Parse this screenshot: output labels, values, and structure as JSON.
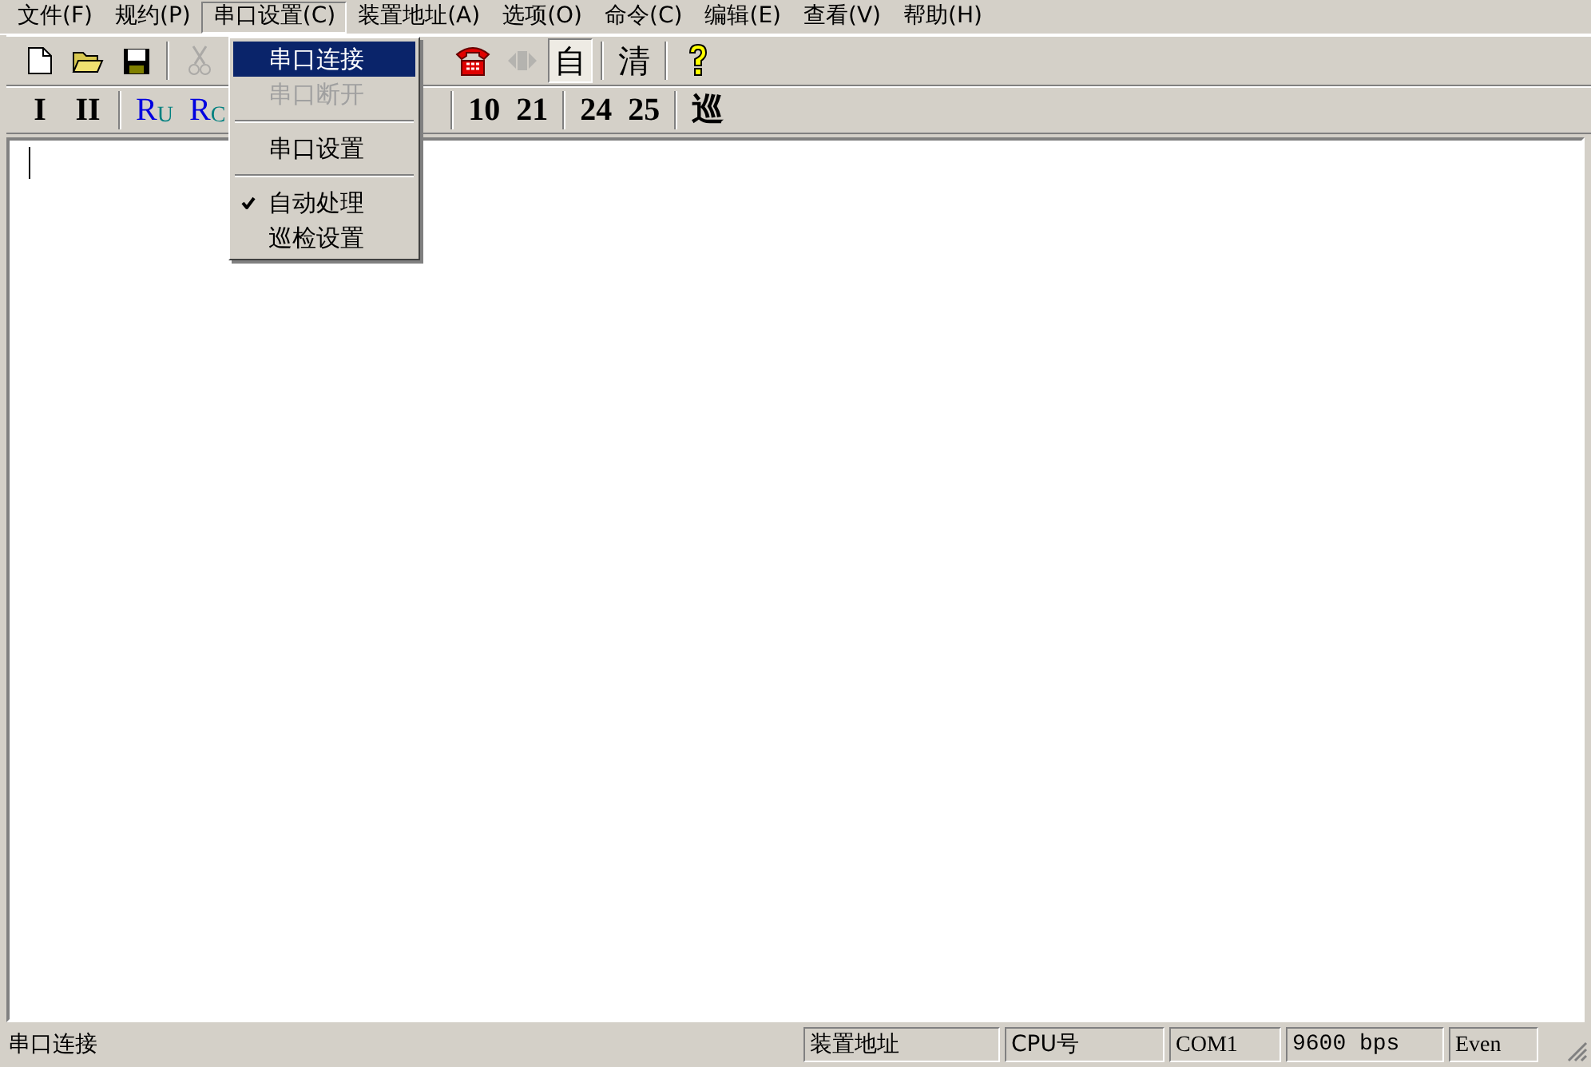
{
  "menu_bar": [
    {
      "label": "文件(F)",
      "selected": false
    },
    {
      "label": "规约(P)",
      "selected": false
    },
    {
      "label": "串口设置(C)",
      "selected": true
    },
    {
      "label": "装置地址(A)",
      "selected": false
    },
    {
      "label": "选项(O)",
      "selected": false
    },
    {
      "label": "命令(C)",
      "selected": false
    },
    {
      "label": "编辑(E)",
      "selected": false
    },
    {
      "label": "查看(V)",
      "selected": false
    },
    {
      "label": "帮助(H)",
      "selected": false
    }
  ],
  "toolbar_1": {
    "left": [
      {
        "kind": "new",
        "disabled": false,
        "pressed": false
      },
      {
        "kind": "open",
        "disabled": false,
        "pressed": false
      },
      {
        "kind": "save",
        "disabled": false,
        "pressed": false
      },
      {
        "kind": "separator"
      },
      {
        "kind": "cut",
        "disabled": true,
        "pressed": false
      }
    ],
    "right": [
      {
        "kind": "phone",
        "disabled": false,
        "pressed": false
      },
      {
        "kind": "plug",
        "disabled": true,
        "pressed": false
      },
      {
        "kind": "text",
        "label": "自",
        "disabled": false,
        "pressed": true
      },
      {
        "kind": "separator"
      },
      {
        "kind": "text",
        "label": "清",
        "disabled": false,
        "pressed": false
      },
      {
        "kind": "separator"
      },
      {
        "kind": "help",
        "disabled": false,
        "pressed": false
      }
    ]
  },
  "toolbar_2": {
    "left": [
      {
        "kind": "text",
        "label": "I",
        "disabled": false,
        "pressed": false
      },
      {
        "kind": "text",
        "label": "II",
        "disabled": false,
        "pressed": false
      },
      {
        "kind": "separator"
      },
      {
        "kind": "text",
        "label": "R$_{U}$",
        "disabled": false,
        "pressed": false
      },
      {
        "kind": "text",
        "label": "R$_{C}$",
        "disabled": false,
        "pressed": false
      }
    ],
    "right": [
      {
        "kind": "separator"
      },
      {
        "kind": "text",
        "label": "10",
        "disabled": false,
        "pressed": false
      },
      {
        "kind": "text",
        "label": "21",
        "disabled": false,
        "pressed": false
      },
      {
        "kind": "separator"
      },
      {
        "kind": "text",
        "label": "24",
        "disabled": false,
        "pressed": false
      },
      {
        "kind": "text",
        "label": "25",
        "disabled": false,
        "pressed": false
      },
      {
        "kind": "separator"
      },
      {
        "kind": "text",
        "label": "巡",
        "disabled": false,
        "pressed": false
      }
    ]
  },
  "dropdown_menu": [
    {
      "kind": "item",
      "label": "串口连接",
      "selected": true,
      "disabled": false,
      "checked": false
    },
    {
      "kind": "item",
      "label": "串口断开",
      "selected": false,
      "disabled": true,
      "checked": false
    },
    {
      "kind": "separator"
    },
    {
      "kind": "item",
      "label": "串口设置",
      "selected": false,
      "disabled": false,
      "checked": false
    },
    {
      "kind": "separator"
    },
    {
      "kind": "item",
      "label": "自动处理",
      "selected": false,
      "disabled": false,
      "checked": true
    },
    {
      "kind": "item",
      "label": "巡检设置",
      "selected": false,
      "disabled": false,
      "checked": false
    }
  ],
  "status_bar": [
    "串口连接",
    "装置地址",
    "CPU号",
    "COM1",
    "9600 bps",
    "Even"
  ]
}
